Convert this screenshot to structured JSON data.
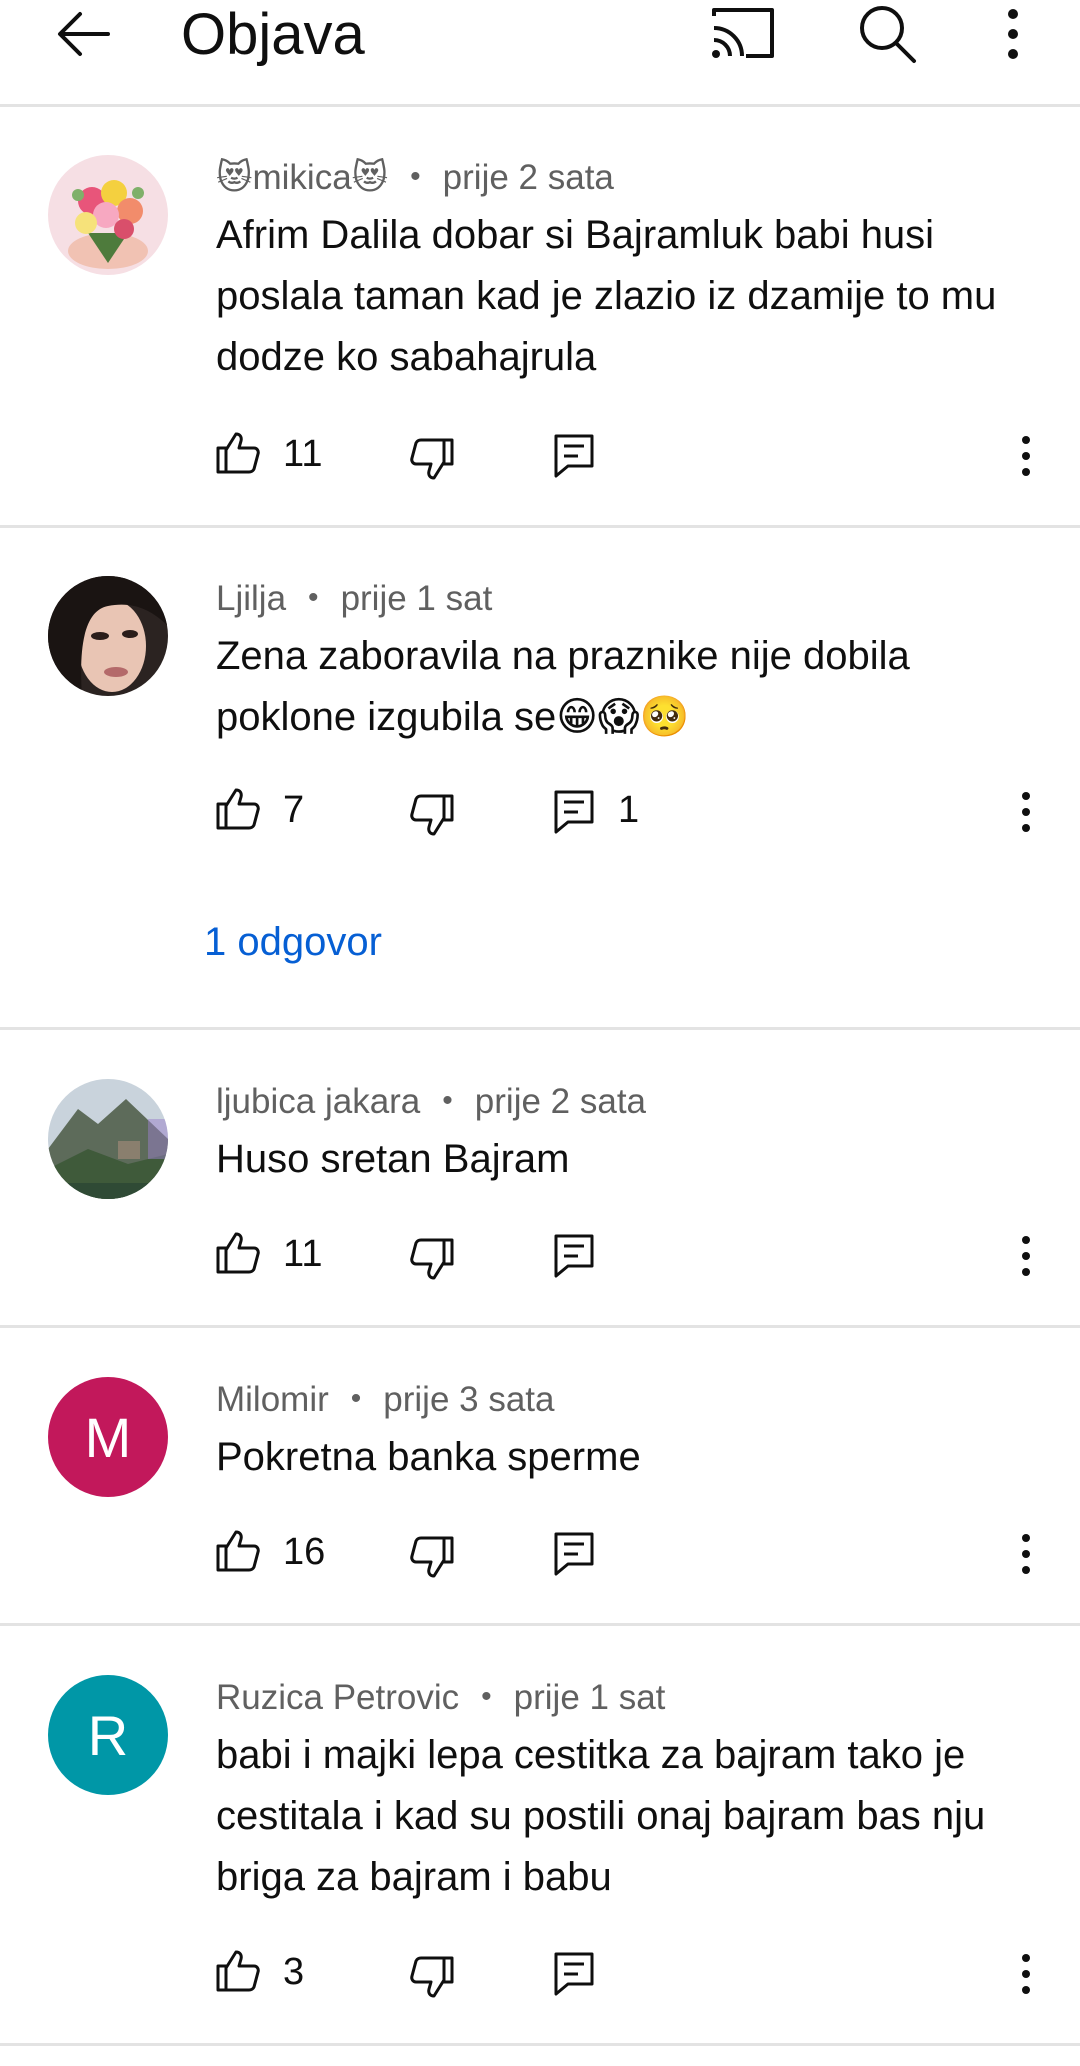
{
  "header": {
    "title": "Objava",
    "back_icon": "arrow-back-icon",
    "cast_icon": "cast-icon",
    "search_icon": "search-icon",
    "more_icon": "more-vert-icon"
  },
  "comments": [
    {
      "author": "😻mikica😻",
      "time": "prije 2 sata",
      "text": "Afrim Dalila dobar si Bajramluk babi husi poslala taman kad je zlazio iz dzamije to mu dodze ko sabahajrula",
      "likes": "11",
      "replies_count": "",
      "avatar": "flowers-photo"
    },
    {
      "author": "Ljilja",
      "time": "prije 1 sat",
      "text": "Zena zaboravila na praznike nije dobila poklone izgubila se😁😱🥺",
      "likes": "7",
      "replies_count": "1",
      "replies_link": "1 odgovor",
      "avatar": "woman-portrait-photo"
    },
    {
      "author": "ljubica jakara",
      "time": "prije 2 sata",
      "text": "Huso sretan Bajram",
      "likes": "11",
      "replies_count": "",
      "avatar": "landscape-photo"
    },
    {
      "author": "Milomir",
      "time": "prije 3 sata",
      "text": "Pokretna banka sperme",
      "likes": "16",
      "replies_count": "",
      "avatar_letter": "M",
      "avatar_color": "#c2185b"
    },
    {
      "author": "Ruzica Petrovic",
      "time": "prije 1 sat",
      "text": "babi i majki lepa cestitka za bajram tako je cestitala i kad su postili onaj bajram bas nju briga za bajram i babu",
      "likes": "3",
      "replies_count": "",
      "avatar_letter": "R",
      "avatar_color": "#0097a7"
    }
  ],
  "colors": {
    "link": "#065fd4",
    "meta": "#606060",
    "divider": "#e3e3e3"
  }
}
